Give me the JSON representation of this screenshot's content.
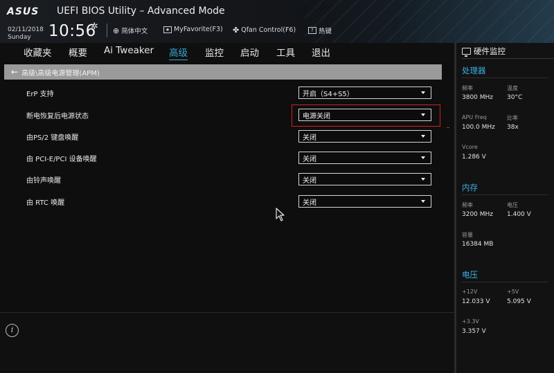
{
  "header": {
    "logo": "ASUS",
    "title": "UEFI BIOS Utility – Advanced Mode",
    "date": "02/11/2018",
    "day": "Sunday",
    "time": "10:56",
    "buttons": [
      {
        "label": "简体中文",
        "icon": "globe-icon"
      },
      {
        "label": "MyFavorite(F3)",
        "icon": "favorite-icon"
      },
      {
        "label": "Qfan Control(F6)",
        "icon": "fan-icon"
      },
      {
        "label": "热键",
        "icon": "hotkey-icon"
      }
    ]
  },
  "nav": {
    "tabs": [
      "收藏夹",
      "概要",
      "Ai Tweaker",
      "高级",
      "监控",
      "启动",
      "工具",
      "退出"
    ],
    "active": "高级"
  },
  "breadcrumb": "高级\\高级电源管理(APM)",
  "settings": [
    {
      "label": "ErP 支持",
      "value": "开启（S4+S5）"
    },
    {
      "label": "断电恢复后电源状态",
      "value": "电源关闭"
    },
    {
      "label": "由PS/2 键盘唤醒",
      "value": "关闭"
    },
    {
      "label": "由 PCI-E/PCI 设备唤醒",
      "value": "关闭"
    },
    {
      "label": "由铃声唤醒",
      "value": "关闭"
    },
    {
      "label": "由 RTC 唤醒",
      "value": "关闭"
    }
  ],
  "monitor": {
    "title": "硬件监控",
    "cpu": {
      "title": "处理器",
      "freq_label": "频率",
      "freq": "3800 MHz",
      "temp_label": "温度",
      "temp": "30°C",
      "apu_label": "APU Freq",
      "apu": "100.0 MHz",
      "ratio_label": "比率",
      "ratio": "38x",
      "vcore_label": "Vcore",
      "vcore": "1.286 V"
    },
    "memory": {
      "title": "内存",
      "freq_label": "频率",
      "freq": "3200 MHz",
      "volt_label": "电压",
      "volt": "1.400 V",
      "cap_label": "容量",
      "cap": "16384 MB"
    },
    "voltage": {
      "title": "电压",
      "v12_label": "+12V",
      "v12": "12.033 V",
      "v5_label": "+5V",
      "v5": "5.095 V",
      "v33_label": "+3.3V",
      "v33": "3.357 V"
    }
  },
  "colors": {
    "accent": "#3aa5d8",
    "highlight": "#d42020",
    "breadcrumb_bg": "#9a9a9a"
  }
}
